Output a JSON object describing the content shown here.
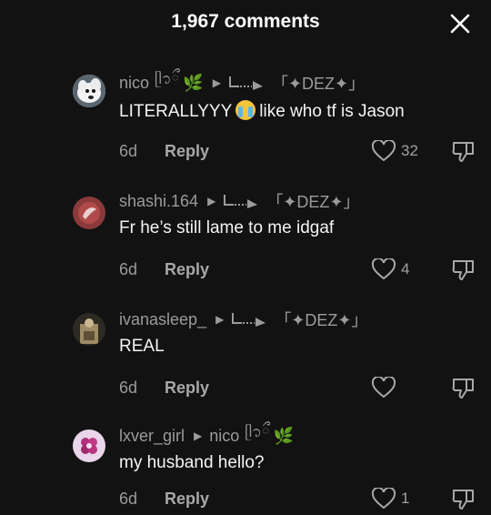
{
  "header": {
    "title": "1,967 comments"
  },
  "comments": [
    {
      "username": "nico",
      "deco": "ᥫ᭡ྀ",
      "leaf": "🌿",
      "reply_to": "「✦DEZ✦」",
      "text_before": "LITERALLYYY",
      "text_after": "like who tf is Jason",
      "age": "6d",
      "reply_label": "Reply",
      "like_count": "32"
    },
    {
      "username": "shashi.164",
      "reply_to": "「✦DEZ✦」",
      "text": "Fr he’s still lame to me idgaf",
      "age": "6d",
      "reply_label": "Reply",
      "like_count": "4"
    },
    {
      "username": "ivanasleep_",
      "reply_to": "「✦DEZ✦」",
      "text": "REAL",
      "age": "6d",
      "reply_label": "Reply",
      "like_count": ""
    },
    {
      "username": "lxver_girl",
      "reply_to": "nico",
      "reply_deco": "ᥫ᭡ྀ",
      "leaf": "🌿",
      "text": "my husband hello?",
      "age": "6d",
      "reply_label": "Reply",
      "like_count": "1"
    }
  ],
  "colors": {
    "background": "#121212",
    "text": "#f2f2f2",
    "muted": "#9b9b9b"
  },
  "icons": [
    "close-icon",
    "heart-icon",
    "dislike-icon",
    "play-arrow-icon",
    "reply-arrow-icon"
  ]
}
